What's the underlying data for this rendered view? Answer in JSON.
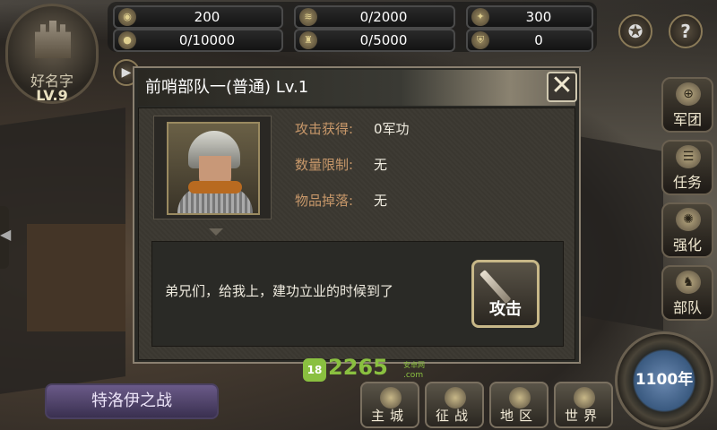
{
  "player": {
    "name": "好名字",
    "level": "LV.9"
  },
  "resources": [
    {
      "icon": "coin-icon",
      "value": "200"
    },
    {
      "icon": "wheat-icon",
      "value": "0/2000"
    },
    {
      "icon": "gem-icon",
      "value": "300"
    },
    {
      "icon": "iron-icon",
      "value": "0/10000"
    },
    {
      "icon": "soldier-icon",
      "value": "0/5000"
    },
    {
      "icon": "shield-icon",
      "value": "0"
    }
  ],
  "help_label": "?",
  "side_menu": [
    {
      "label": "军团",
      "icon": "legion-icon"
    },
    {
      "label": "任务",
      "icon": "quest-icon"
    },
    {
      "label": "强化",
      "icon": "upgrade-icon"
    },
    {
      "label": "部队",
      "icon": "troops-icon"
    }
  ],
  "dialog": {
    "title": "前哨部队一(普通) Lv.1",
    "close": "✕",
    "rows": [
      {
        "key": "攻击获得:",
        "value": "0军功"
      },
      {
        "key": "数量限制:",
        "value": "无"
      },
      {
        "key": "物品掉落:",
        "value": "无"
      }
    ],
    "message": "弟兄们，给我上，建功立业的时候到了",
    "attack_label": "攻击"
  },
  "campaign_label": "特洛伊之战",
  "bottom_nav": [
    "主城",
    "征战",
    "地区",
    "世界"
  ],
  "year_label": "1100年",
  "watermark": {
    "main": "2265",
    "sub": "安卓网",
    "domain": ".com",
    "badge": "18"
  }
}
